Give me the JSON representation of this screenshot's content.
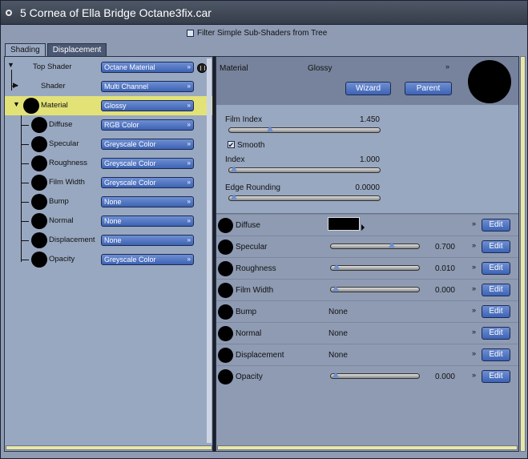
{
  "window": {
    "title": "5  Cornea of Ella Bridge Octane3fix.car"
  },
  "filter": {
    "label": "Filter Simple Sub-Shaders from Tree",
    "checked": false
  },
  "tabs": [
    {
      "label": "Shading",
      "active": true
    },
    {
      "label": "Displacement",
      "active": false
    }
  ],
  "tree": {
    "top": {
      "label": "Top Shader",
      "value": "Octane Material"
    },
    "shader": {
      "label": "Shader",
      "value": "Multi Channel"
    },
    "material": {
      "label": "Material",
      "value": "Glossy"
    },
    "channels": [
      {
        "label": "Diffuse",
        "value": "RGB Color"
      },
      {
        "label": "Specular",
        "value": "Greyscale Color"
      },
      {
        "label": "Roughness",
        "value": "Greyscale Color"
      },
      {
        "label": "Film Width",
        "value": "Greyscale Color"
      },
      {
        "label": "Bump",
        "value": "None"
      },
      {
        "label": "Normal",
        "value": "None"
      },
      {
        "label": "Displacement",
        "value": "None"
      },
      {
        "label": "Opacity",
        "value": "Greyscale Color"
      }
    ]
  },
  "right": {
    "header_label": "Material",
    "header_type": "Glossy",
    "wizard_label": "Wizard",
    "parent_label": "Parent",
    "film_index": {
      "label": "Film Index",
      "value": "1.450",
      "fraction": 0.25
    },
    "smooth": {
      "label": "Smooth",
      "checked": true
    },
    "index": {
      "label": "Index",
      "value": "1.000",
      "fraction": 0.0
    },
    "edge": {
      "label": "Edge Rounding",
      "value": "0.0000",
      "fraction": 0.0
    },
    "channels": [
      {
        "label": "Diffuse",
        "kind": "color",
        "value": "",
        "fraction": null,
        "edit": "Edit"
      },
      {
        "label": "Specular",
        "kind": "slider",
        "value": "0.700",
        "fraction": 0.7,
        "edit": "Edit"
      },
      {
        "label": "Roughness",
        "kind": "slider",
        "value": "0.010",
        "fraction": 0.01,
        "edit": "Edit"
      },
      {
        "label": "Film Width",
        "kind": "slider",
        "value": "0.000",
        "fraction": 0.0,
        "edit": "Edit"
      },
      {
        "label": "Bump",
        "kind": "none",
        "value": "None",
        "fraction": null,
        "edit": "Edit"
      },
      {
        "label": "Normal",
        "kind": "none",
        "value": "None",
        "fraction": null,
        "edit": "Edit"
      },
      {
        "label": "Displacement",
        "kind": "none",
        "value": "None",
        "fraction": null,
        "edit": "Edit"
      },
      {
        "label": "Opacity",
        "kind": "slider",
        "value": "0.000",
        "fraction": 0.0,
        "edit": "Edit"
      }
    ]
  },
  "colors": {
    "accent": "#3d63b4",
    "highlight": "#e3e277",
    "panel": "#99a8c1"
  }
}
